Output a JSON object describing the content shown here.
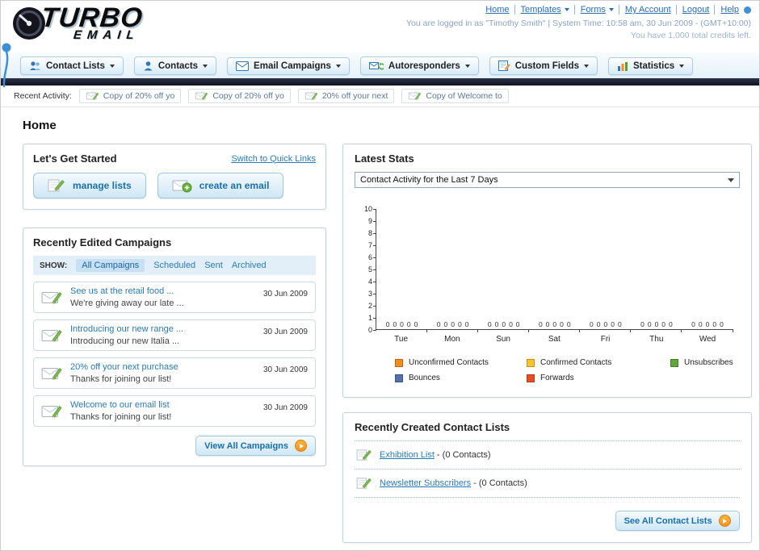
{
  "header": {
    "logo": {
      "title": "TURBO",
      "subtitle": "EMAIL"
    },
    "nav_links": [
      {
        "label": "Home",
        "dropdown": false
      },
      {
        "label": "Templates",
        "dropdown": true
      },
      {
        "label": "Forms",
        "dropdown": true
      },
      {
        "label": "My Account",
        "dropdown": false
      },
      {
        "label": "Logout",
        "dropdown": false
      },
      {
        "label": "Help",
        "dropdown": false
      }
    ],
    "login_line": "You are logged in as \"Timothy Smith\" | System Time: 10:58 am, 30 Jun 2009 - (GMT+10:00)",
    "credits_line": "You have 1,000 total credits left."
  },
  "main_nav": {
    "tabs": [
      {
        "label": "Contact Lists",
        "icon": "contact-lists-icon"
      },
      {
        "label": "Contacts",
        "icon": "contacts-icon"
      },
      {
        "label": "Email Campaigns",
        "icon": "email-campaigns-icon"
      },
      {
        "label": "Autoresponders",
        "icon": "autoresponders-icon"
      },
      {
        "label": "Custom Fields",
        "icon": "custom-fields-icon"
      },
      {
        "label": "Statistics",
        "icon": "statistics-icon"
      }
    ]
  },
  "recent_activity": {
    "label": "Recent Activity:",
    "items": [
      {
        "label": "Copy of 20% off yo"
      },
      {
        "label": "Copy of 20% off yo"
      },
      {
        "label": "20% off your next"
      },
      {
        "label": "Copy of Welcome to"
      }
    ]
  },
  "page_title": "Home",
  "get_started": {
    "title": "Let's Get Started",
    "switch_link": "Switch to Quick Links",
    "buttons": [
      {
        "label": "manage lists"
      },
      {
        "label": "create an email"
      }
    ]
  },
  "campaigns": {
    "title": "Recently Edited Campaigns",
    "show_label": "SHOW:",
    "tabs": [
      "All Campaigns",
      "Scheduled",
      "Sent",
      "Archived"
    ],
    "active_tab": "All Campaigns",
    "items": [
      {
        "title": "See us at the retail food ...",
        "subtitle": "We're giving away our late ...",
        "date": "30 Jun 2009"
      },
      {
        "title": "Introducing our new range ...",
        "subtitle": "Introducing our new Italia ...",
        "date": "30 Jun 2009"
      },
      {
        "title": "20% off your next purchase",
        "subtitle": "Thanks for joining our list!",
        "date": "30 Jun 2009"
      },
      {
        "title": "Welcome to our email list",
        "subtitle": "Thanks for joining our list!",
        "date": "30 Jun 2009"
      }
    ],
    "view_all_label": "View All Campaigns"
  },
  "latest_stats": {
    "title": "Latest Stats",
    "period_selected": "Contact Activity for the Last 7 Days"
  },
  "chart_data": {
    "type": "bar",
    "title": "Contact Activity for the Last 7 Days",
    "categories": [
      "Tue",
      "Mon",
      "Sun",
      "Sat",
      "Fri",
      "Thu",
      "Wed"
    ],
    "series": [
      {
        "name": "Unconfirmed Contacts",
        "color": "#f68b1f",
        "values": [
          0,
          0,
          0,
          0,
          0,
          0,
          0
        ]
      },
      {
        "name": "Confirmed Contacts",
        "color": "#fdc42f",
        "values": [
          0,
          0,
          0,
          0,
          0,
          0,
          0
        ]
      },
      {
        "name": "Unsubscribes",
        "color": "#61a53b",
        "values": [
          0,
          0,
          0,
          0,
          0,
          0,
          0
        ]
      },
      {
        "name": "Bounces",
        "color": "#5271a8",
        "values": [
          0,
          0,
          0,
          0,
          0,
          0,
          0
        ]
      },
      {
        "name": "Forwards",
        "color": "#e94f23",
        "values": [
          0,
          0,
          0,
          0,
          0,
          0,
          0
        ]
      }
    ],
    "xlabel": "",
    "ylabel": "",
    "ylim": [
      0,
      10
    ],
    "y_ticks": [
      0,
      1,
      2,
      3,
      4,
      5,
      6,
      7,
      8,
      9,
      10
    ],
    "grid": false,
    "legend_position": "bottom",
    "show_value_labels": true
  },
  "contact_lists": {
    "title": "Recently Created Contact Lists",
    "items": [
      {
        "name": "Exhibition List",
        "suffix": " - (0 Contacts)"
      },
      {
        "name": "Newsletter Subscribers",
        "suffix": " - (0 Contacts)"
      }
    ],
    "see_all_label": "See All Contact Lists"
  },
  "colors": {
    "accent_blue": "#2a7ab9",
    "dark_bar": "#12152a",
    "button_text": "#1a6fae",
    "orange_arrow": "#f7941e",
    "annotation_blue": "#3f8fd6"
  }
}
